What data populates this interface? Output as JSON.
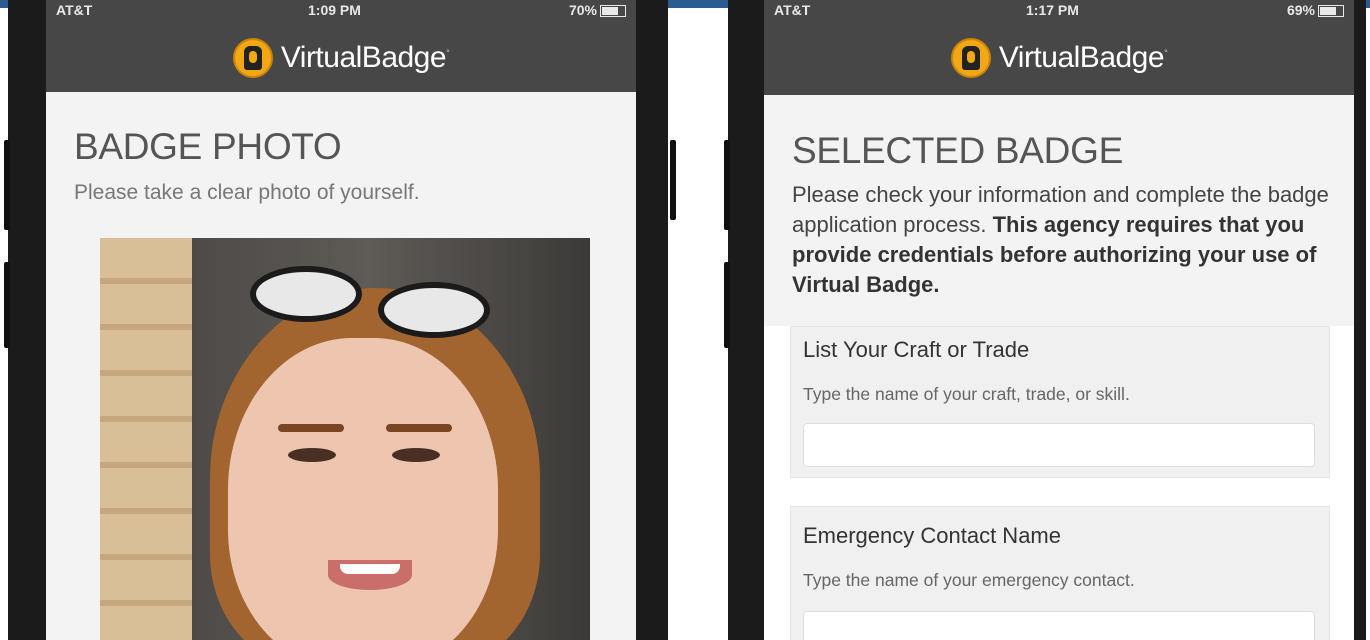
{
  "left_phone": {
    "status": {
      "carrier": "AT&T",
      "time": "1:09 PM",
      "battery": "70%"
    },
    "brand": "VirtualBadge",
    "title": "BADGE PHOTO",
    "subtitle": "Please take a clear photo of yourself."
  },
  "right_phone": {
    "status": {
      "carrier": "AT&T",
      "time": "1:17 PM",
      "battery": "69%"
    },
    "brand": "VirtualBadge",
    "title": "SELECTED BADGE",
    "description": "Please check your information and complete the badge application process.",
    "description_bold": "This agency requires that you provide credentials before authorizing your use of Virtual Badge.",
    "fields": [
      {
        "label": "List Your Craft or Trade",
        "help": "Type the name of your craft, trade, or skill.",
        "value": ""
      },
      {
        "label": "Emergency Contact Name",
        "help": "Type the name of your emergency contact.",
        "value": ""
      }
    ]
  },
  "colors": {
    "header_bg": "#474747",
    "logo_accent": "#f2a714",
    "top_band": "#2a5d8f"
  }
}
